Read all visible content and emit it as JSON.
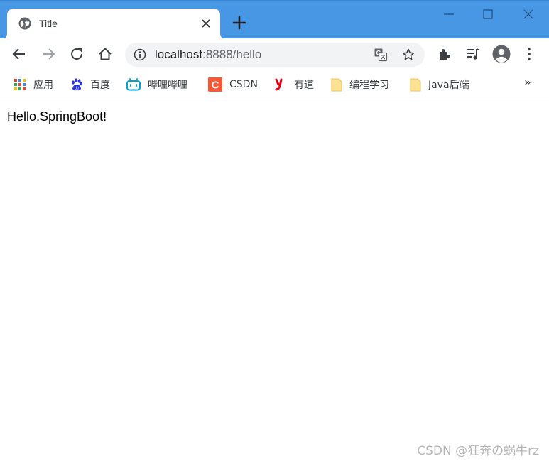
{
  "tab": {
    "title": "Title"
  },
  "omnibox": {
    "host": "localhost",
    "path": ":8888/hello"
  },
  "bookmarks": [
    {
      "label": "应用",
      "icon": "apps-grid-icon"
    },
    {
      "label": "百度",
      "icon": "baidu-icon"
    },
    {
      "label": "哔哩哔哩",
      "icon": "bilibili-icon"
    },
    {
      "label": "CSDN",
      "icon": "csdn-icon"
    },
    {
      "label": "有道",
      "icon": "youdao-icon"
    },
    {
      "label": "编程学习",
      "icon": "folder-icon"
    },
    {
      "label": "Java后端",
      "icon": "folder-icon"
    }
  ],
  "bookmarks_more": "»",
  "page": {
    "text": "Hello,SpringBoot!"
  },
  "watermark": "CSDN @狂奔の蜗牛rz",
  "colors": {
    "titlebar": "#4797e4",
    "omnibox_bg": "#f1f3f4"
  }
}
